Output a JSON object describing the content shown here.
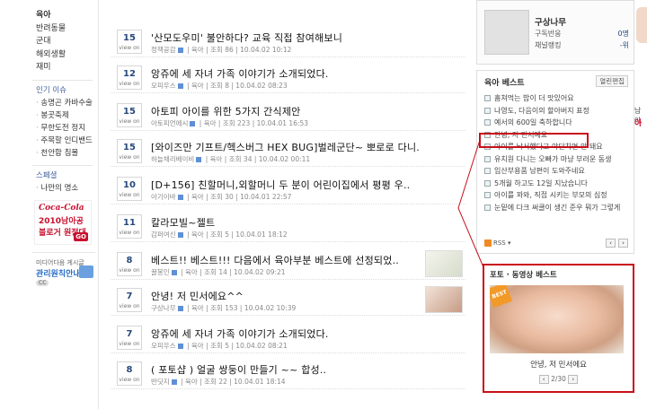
{
  "left": {
    "categories": [
      "육아",
      "반려동물",
      "군대",
      "해외생활",
      "재미"
    ],
    "issues_title": "인기 이슈",
    "issues": [
      "송명곤 카바수술",
      "봉곳축제",
      "무한도전 정지",
      "주목할 인디밴드",
      "천안함 침몰"
    ],
    "scrap_title": "스페셜",
    "scrap_item": "나만의 명소",
    "promo1": {
      "brand": "Coca-Cola",
      "line1": "2010남아공",
      "line2": "블로거 원정대",
      "go": "GO"
    },
    "promo2": {
      "small": "미디어다음 게시글",
      "big": "관리원칙안내",
      "badge": "CC"
    }
  },
  "posts": [
    {
      "views": "15",
      "view_label": "view on",
      "title": "'산모도우미' 불안하다? 교육 직접 참여해보니",
      "author": "정책공감",
      "cat": "육아",
      "hits_label": "조회",
      "hits": "86",
      "date": "10.04.02 10:12"
    },
    {
      "views": "12",
      "view_label": "view on",
      "title": "앙쥬에 세 자녀 가족 이야기가 소개되었다.",
      "author": "모피우스",
      "cat": "육아",
      "hits_label": "조회",
      "hits": "8",
      "date": "10.04.02 08:23"
    },
    {
      "views": "15",
      "view_label": "view on",
      "title": "아토피 아이를 위한 5가지 간식제안",
      "author": "아토피언에시",
      "cat": "육아",
      "hits_label": "조회",
      "hits": "223",
      "date": "10.04.01 16:53"
    },
    {
      "views": "15",
      "view_label": "view on",
      "title": "[와이즈만 기프트/헥스버그 HEX BUG]벌레군단~ 뽀로로 다니..",
      "author": "하늘채리베이비",
      "cat": "육아",
      "hits_label": "조회",
      "hits": "34",
      "date": "10.04.02 00:11"
    },
    {
      "views": "10",
      "view_label": "view on",
      "title": "[D+156] 친할머니,외할머니 두 분이 어린이집에서 평평 우..",
      "author": "아기이바",
      "cat": "육아",
      "hits_label": "조회",
      "hits": "30",
      "date": "10.04.01 22:57"
    },
    {
      "views": "11",
      "view_label": "view on",
      "title": "칼라모빌~젤트",
      "author": "감퍼여신",
      "cat": "육아",
      "hits_label": "조회",
      "hits": "5",
      "date": "10.04.01 18:12"
    },
    {
      "views": "8",
      "view_label": "view on",
      "title": "베스트!! 베스트!!! 다음에서 육아부분 베스트에 선정되었..",
      "author": "꿀봉인",
      "cat": "육아",
      "hits_label": "조회",
      "hits": "14",
      "date": "10.04.02 09:21"
    },
    {
      "views": "7",
      "view_label": "view on",
      "title": "안녕! 저 민서에요^^",
      "author": "구상나무",
      "cat": "육아",
      "hits_label": "조회",
      "hits": "153",
      "date": "10.04.02 10:39"
    },
    {
      "views": "7",
      "view_label": "view on",
      "title": "앙쥬에 세 자녀 가족 이야기가 소개되었다.",
      "author": "모피우스",
      "cat": "육아",
      "hits_label": "조회",
      "hits": "5",
      "date": "10.04.02 08:21"
    },
    {
      "views": "8",
      "view_label": "view on",
      "title": "( 포토샵 ) 얼굴 쌍둥이 만들기 ~~ 합성..",
      "author": "반딧지",
      "cat": "육아",
      "hits_label": "조회",
      "hits": "22",
      "date": "10.04.01 18:14"
    }
  ],
  "profile": {
    "name": "구상나무",
    "row1_label": "구독반응",
    "row1_value": "0명",
    "row2_label": "채널랭킹",
    "row2_value": "-위"
  },
  "best": {
    "title": "육아 베스트",
    "edit": "열린편집",
    "items": [
      "훔쳐먹는 밥이 더 맛있어요",
      "나영도, 다음이의 할아버지 표정",
      "예서의 600일 축하합니다",
      "안녕, 저 민서예요",
      "아이를 낙서했다고 야단치면 안 돼요",
      "유치원 다니는 오빠가 마냥 부러운 동생",
      "임산부용품 남편이 도와주네요",
      "5개월 하고도 12일 지났습니다",
      "아이를 꽈와, 직접 시키는 부모의 심정",
      "눈밑에 다크 써클이 생긴 준우 뭐가 그렇게"
    ],
    "rss": "RSS"
  },
  "photo_best": {
    "title": "포토 · 동영상 베스트",
    "badge": "BEST",
    "caption": "안녕, 저 민서에요",
    "page": "2/30"
  },
  "edge": {
    "text1": "남아",
    "text2": "아"
  },
  "colors": {
    "accent_red": "#c8101a",
    "link_blue": "#27497b"
  }
}
